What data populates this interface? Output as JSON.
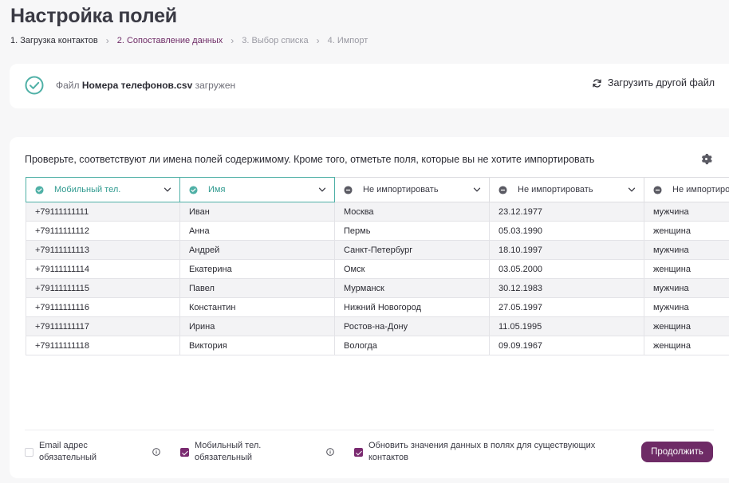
{
  "page_title": "Настройка полей",
  "breadcrumb": [
    {
      "label": "1. Загрузка контактов",
      "state": "done"
    },
    {
      "label": "2. Сопоставление данных",
      "state": "active"
    },
    {
      "label": "3. Выбор списка",
      "state": "pending"
    },
    {
      "label": "4. Импорт",
      "state": "pending"
    }
  ],
  "file_card": {
    "prefix": "Файл",
    "filename": "Номера телефонов.csv",
    "suffix": "загружен",
    "reload_label": "Загрузить другой файл"
  },
  "instruction": "Проверьте, соответствуют ли имена полей содержимому. Кроме того, отметьте поля, которые вы не хотите импортировать",
  "columns": [
    {
      "label": "Мобильный тел.",
      "state": "mapped"
    },
    {
      "label": "Имя",
      "state": "mapped"
    },
    {
      "label": "Не импортировать",
      "state": "skip"
    },
    {
      "label": "Не импортировать",
      "state": "skip"
    },
    {
      "label": "Не импортировать",
      "state": "skip"
    }
  ],
  "rows": [
    [
      "+79111111111",
      "Иван",
      "Москва",
      "23.12.1977",
      "мужчина"
    ],
    [
      "+79111111112",
      "Анна",
      "Пермь",
      "05.03.1990",
      "женщина"
    ],
    [
      "+79111111113",
      "Андрей",
      "Санкт-Петербург",
      "18.10.1997",
      "мужчина"
    ],
    [
      "+79111111114",
      "Екатерина",
      "Омск",
      "03.05.2000",
      "женщина"
    ],
    [
      "+79111111115",
      "Павел",
      "Мурманск",
      "30.12.1983",
      "мужчина"
    ],
    [
      "+79111111116",
      "Константин",
      "Нижний Новогород",
      "27.05.1997",
      "мужчина"
    ],
    [
      "+79111111117",
      "Ирина",
      "Ростов-на-Дону",
      "11.05.1995",
      "женщина"
    ],
    [
      "+79111111118",
      "Виктория",
      "Вологда",
      "09.09.1967",
      "женщина"
    ]
  ],
  "options": {
    "email_required": {
      "line1": "Email адрес",
      "line2": "обязательный",
      "checked": false
    },
    "phone_required": {
      "line1": "Мобильный тел.",
      "line2": "обязательный",
      "checked": true
    },
    "update_existing": {
      "line1": "Обновить значения данных в полях для существующих",
      "line2": "контактов",
      "checked": true
    }
  },
  "continue_label": "Продолжить",
  "colors": {
    "accent": "#6e2b66",
    "mapped": "#4fb0a6",
    "skip_icon": "#5a5a63"
  }
}
